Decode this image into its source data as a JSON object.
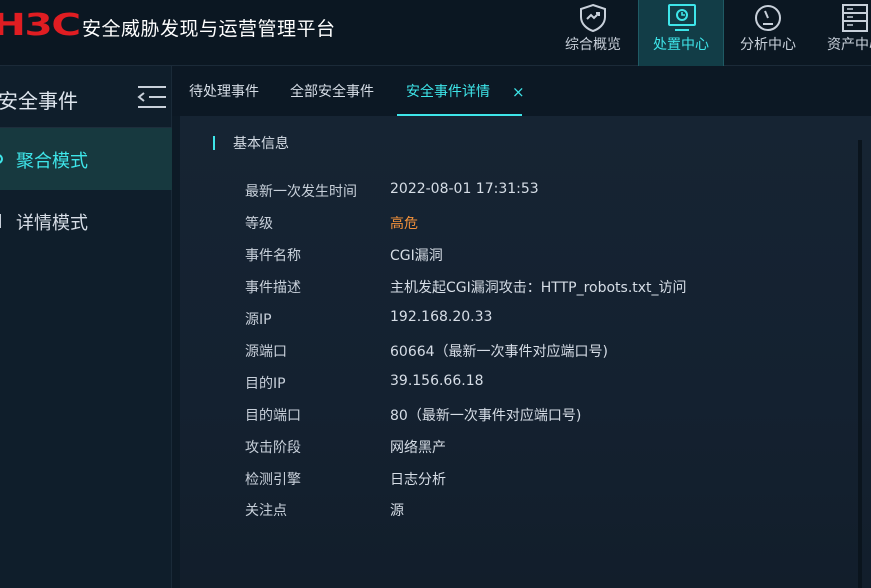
{
  "app": {
    "logo_text": "H3C",
    "title": "安全威胁发现与运营管理平台"
  },
  "nav": [
    {
      "label": "综合概览",
      "icon": "shield-check-icon"
    },
    {
      "label": "处置中心",
      "icon": "monitor-icon",
      "active": true
    },
    {
      "label": "分析中心",
      "icon": "gauge-icon"
    },
    {
      "label": "资产中心",
      "icon": "server-icon"
    }
  ],
  "sidebar": {
    "title": "安全事件",
    "items": [
      {
        "label": "聚合模式",
        "active": true
      },
      {
        "label": "详情模式"
      }
    ]
  },
  "tabs": [
    {
      "label": "待处理事件"
    },
    {
      "label": "全部安全事件"
    },
    {
      "label": "安全事件详情",
      "active": true,
      "closable": true,
      "close_glyph": "×"
    }
  ],
  "detail": {
    "section_title": "基本信息",
    "fields": [
      {
        "key": "最新一次发生时间",
        "value": "2022-08-01 17:31:53"
      },
      {
        "key": "等级",
        "value": "高危"
      },
      {
        "key": "事件名称",
        "value": "CGI漏洞"
      },
      {
        "key": "事件描述",
        "value": "主机发起CGI漏洞攻击：HTTP_robots.txt_访问"
      },
      {
        "key": "源IP",
        "value": "192.168.20.33"
      },
      {
        "key": "源端口",
        "value": "60664（最新一次事件对应端口号)"
      },
      {
        "key": "目的IP",
        "value": "39.156.66.18"
      },
      {
        "key": "目的端口",
        "value": "80（最新一次事件对应端口号)"
      },
      {
        "key": "攻击阶段",
        "value": "网络黑产"
      },
      {
        "key": "检测引擎",
        "value": "日志分析"
      },
      {
        "key": "关注点",
        "value": "源"
      }
    ]
  },
  "colors": {
    "accent": "#3ee5e9",
    "logo": "#e01d22",
    "severity_high": "#f2913a",
    "background": "#0d1a26"
  }
}
